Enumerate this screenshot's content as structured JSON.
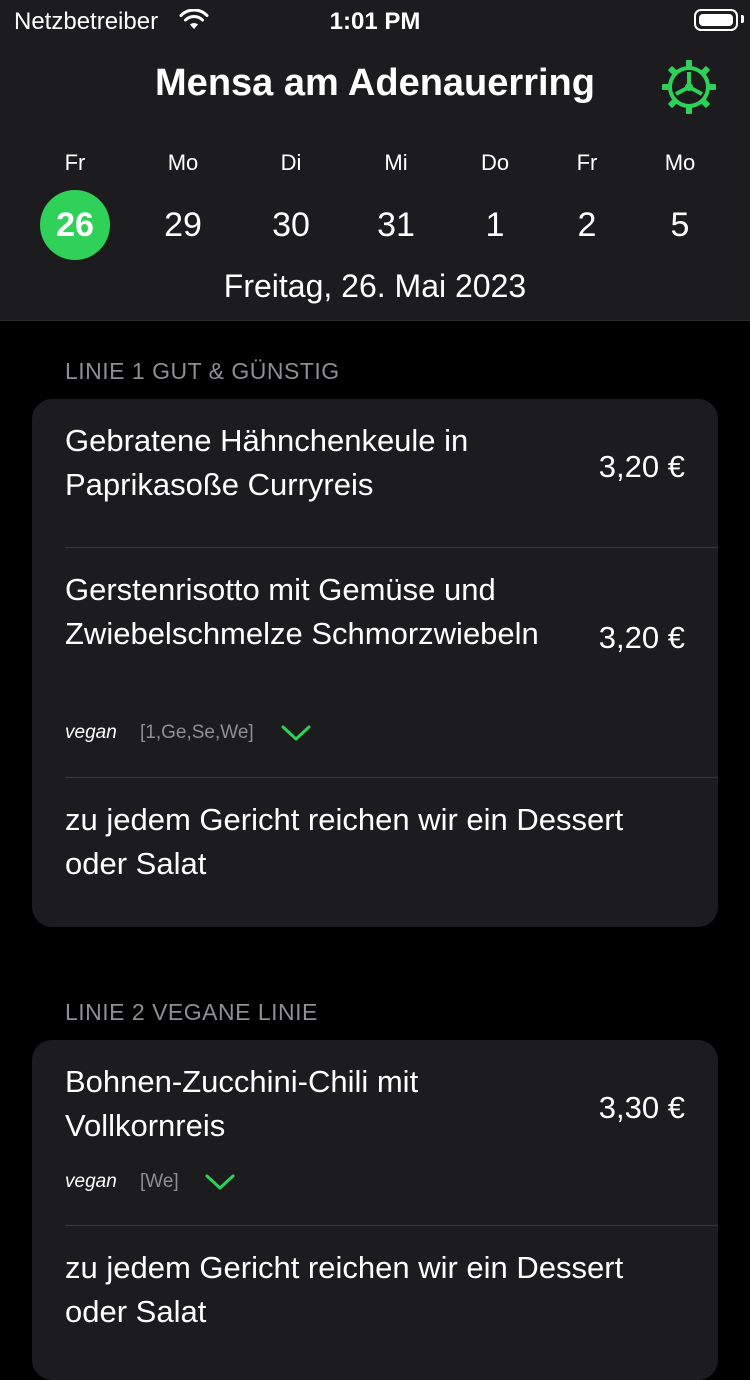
{
  "status": {
    "carrier": "Netzbetreiber",
    "time": "1:01 PM"
  },
  "header": {
    "title": "Mensa am Adenauerring",
    "full_date": "Freitag, 26. Mai 2023"
  },
  "days": [
    {
      "wd": "Fr",
      "num": "26"
    },
    {
      "wd": "Mo",
      "num": "29"
    },
    {
      "wd": "Di",
      "num": "30"
    },
    {
      "wd": "Mi",
      "num": "31"
    },
    {
      "wd": "Do",
      "num": "1"
    },
    {
      "wd": "Fr",
      "num": "2"
    },
    {
      "wd": "Mo",
      "num": "5"
    }
  ],
  "sections": [
    {
      "title": "LINIE 1 GUT & GÜNSTIG",
      "items": [
        {
          "name": "Gebratene Hähnchenkeule in Paprikasoße Curryreis",
          "price": "3,20 €"
        },
        {
          "name": "Gerstenrisotto mit Gemüse und Zwiebelschmelze Schmorzwiebeln",
          "price": "3,20 €",
          "tag": "vegan",
          "allergens": "[1,Ge,Se,We]"
        },
        {
          "name": "zu jedem Gericht reichen wir ein Dessert oder Salat"
        }
      ]
    },
    {
      "title": "LINIE 2 VEGANE LINIE",
      "items": [
        {
          "name": "Bohnen-Zucchini-Chili mit Vollkornreis",
          "price": "3,30 €",
          "tag": "vegan",
          "allergens": "[We]"
        },
        {
          "name": "zu jedem Gericht reichen wir ein Dessert oder Salat"
        }
      ]
    }
  ],
  "colors": {
    "accent": "#2fd158",
    "card": "#1c1c1e",
    "secondary_text": "#8e8e93"
  },
  "icons": {
    "settings": "gear-icon",
    "expand": "chevron-down-icon",
    "wifi": "wifi-icon",
    "battery": "battery-icon"
  }
}
